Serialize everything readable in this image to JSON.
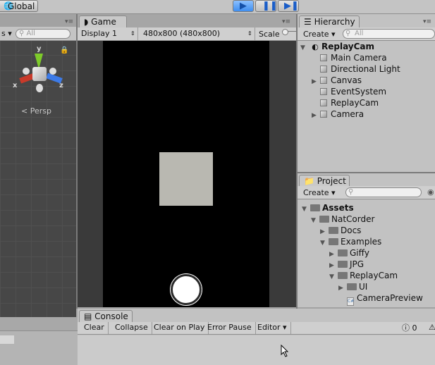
{
  "toolbar": {
    "global_label": "Global"
  },
  "scene": {
    "search_placeholder": "All",
    "persp_label": "Persp",
    "left_dropdown": "s"
  },
  "game": {
    "tab_label": "Game",
    "display": "Display 1",
    "resolution": "480x800 (480x800)",
    "scale_label": "Scale"
  },
  "hierarchy": {
    "tab_label": "Hierarchy",
    "create_label": "Create",
    "search_placeholder": "All",
    "scene_name": "ReplayCam",
    "items": [
      {
        "label": "Main Camera",
        "expandable": false
      },
      {
        "label": "Directional Light",
        "expandable": false
      },
      {
        "label": "Canvas",
        "expandable": true
      },
      {
        "label": "EventSystem",
        "expandable": false
      },
      {
        "label": "ReplayCam",
        "expandable": false
      },
      {
        "label": "Camera",
        "expandable": true
      }
    ]
  },
  "project": {
    "tab_label": "Project",
    "create_label": "Create",
    "tree": [
      {
        "label": "Assets",
        "type": "folder",
        "depth": 0,
        "state": "open",
        "bold": true
      },
      {
        "label": "NatCorder",
        "type": "folder",
        "depth": 1,
        "state": "open"
      },
      {
        "label": "Docs",
        "type": "folder",
        "depth": 2,
        "state": "closed"
      },
      {
        "label": "Examples",
        "type": "folder",
        "depth": 2,
        "state": "open"
      },
      {
        "label": "Giffy",
        "type": "folder",
        "depth": 3,
        "state": "closed"
      },
      {
        "label": "JPG",
        "type": "folder",
        "depth": 3,
        "state": "closed"
      },
      {
        "label": "ReplayCam",
        "type": "folder",
        "depth": 3,
        "state": "open"
      },
      {
        "label": "UI",
        "type": "folder",
        "depth": 4,
        "state": "closed"
      },
      {
        "label": "CameraPreview",
        "type": "script",
        "depth": 4,
        "state": "none"
      }
    ]
  },
  "console": {
    "tab_label": "Console",
    "buttons": [
      "Clear",
      "Collapse",
      "Clear on Play",
      "Error Pause",
      "Editor"
    ],
    "error_count": "0"
  },
  "colors": {
    "play_accent": "#3f8ef0",
    "cube": "#b9b8b1"
  }
}
